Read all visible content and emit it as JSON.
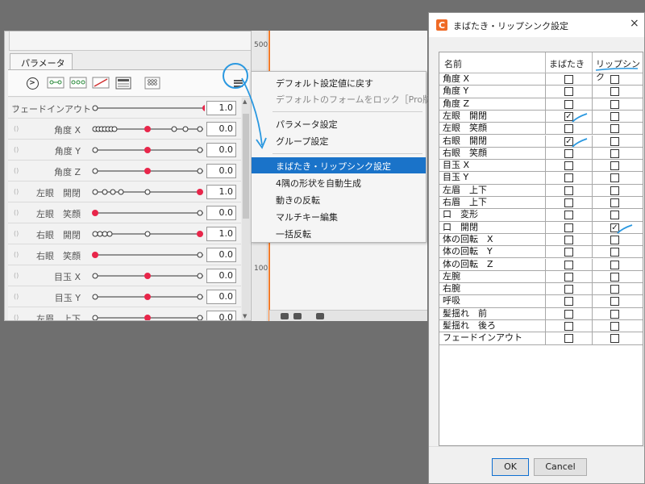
{
  "param_panel": {
    "tab_label": "パラメータ",
    "rows": [
      {
        "name": "フェードインアウト",
        "value": "1.0"
      },
      {
        "name": "角度 X",
        "value": "0.0"
      },
      {
        "name": "角度 Y",
        "value": "0.0"
      },
      {
        "name": "角度 Z",
        "value": "0.0"
      },
      {
        "name": "左眼　開閉",
        "value": "1.0"
      },
      {
        "name": "左眼　笑顔",
        "value": "0.0"
      },
      {
        "name": "右眼　開閉",
        "value": "1.0"
      },
      {
        "name": "右眼　笑顔",
        "value": "0.0"
      },
      {
        "name": "目玉 X",
        "value": "0.0"
      },
      {
        "name": "目玉 Y",
        "value": "0.0"
      },
      {
        "name": "左眉　上下",
        "value": "0.0"
      }
    ]
  },
  "canvas": {
    "ruler_labels": [
      "500",
      "100"
    ]
  },
  "context_menu": {
    "items": [
      {
        "label": "デフォルト設定値に戻す",
        "state": "normal"
      },
      {
        "label": "デフォルトのフォームをロック［Pro版］",
        "state": "disabled"
      },
      {
        "label": "パラメータ設定",
        "state": "normal"
      },
      {
        "label": "グループ設定",
        "state": "normal"
      },
      {
        "label": "まばたき・リップシンク設定",
        "state": "selected"
      },
      {
        "label": "4隅の形状を自動生成",
        "state": "normal"
      },
      {
        "label": "動きの反転",
        "state": "normal"
      },
      {
        "label": "マルチキー編集",
        "state": "normal"
      },
      {
        "label": "一括反転",
        "state": "normal"
      }
    ]
  },
  "dialog": {
    "title": "まばたき・リップシンク設定",
    "close_glyph": "×",
    "headers": {
      "name": "名前",
      "blink": "まばたき",
      "lipsync": "リップシンク"
    },
    "rows": [
      {
        "name": "角度 X",
        "blink": false,
        "lipsync": false
      },
      {
        "name": "角度 Y",
        "blink": false,
        "lipsync": false
      },
      {
        "name": "角度 Z",
        "blink": false,
        "lipsync": false
      },
      {
        "name": "左眼　開閉",
        "blink": true,
        "lipsync": false
      },
      {
        "name": "左眼　笑顔",
        "blink": false,
        "lipsync": false
      },
      {
        "name": "右眼　開閉",
        "blink": true,
        "lipsync": false
      },
      {
        "name": "右眼　笑顔",
        "blink": false,
        "lipsync": false
      },
      {
        "name": "目玉 X",
        "blink": false,
        "lipsync": false
      },
      {
        "name": "目玉 Y",
        "blink": false,
        "lipsync": false
      },
      {
        "name": "左眉　上下",
        "blink": false,
        "lipsync": false
      },
      {
        "name": "右眉　上下",
        "blink": false,
        "lipsync": false
      },
      {
        "name": "口　変形",
        "blink": false,
        "lipsync": false
      },
      {
        "name": "口　開閉",
        "blink": false,
        "lipsync": true
      },
      {
        "name": "体の回転　X",
        "blink": false,
        "lipsync": false
      },
      {
        "name": "体の回転　Y",
        "blink": false,
        "lipsync": false
      },
      {
        "name": "体の回転　Z",
        "blink": false,
        "lipsync": false
      },
      {
        "name": "左腕",
        "blink": false,
        "lipsync": false
      },
      {
        "name": "右腕",
        "blink": false,
        "lipsync": false
      },
      {
        "name": "呼吸",
        "blink": false,
        "lipsync": false
      },
      {
        "name": "髪揺れ　前",
        "blink": false,
        "lipsync": false
      },
      {
        "name": "髪揺れ　後ろ",
        "blink": false,
        "lipsync": false
      },
      {
        "name": "フェードインアウト",
        "blink": false,
        "lipsync": false
      }
    ],
    "ok_label": "OK",
    "cancel_label": "Cancel"
  },
  "colors": {
    "accent": "#1a73c9",
    "keyframe_red": "#e8264a",
    "annotation_blue": "#2a98e0",
    "timeline_orange": "#f07a2a"
  },
  "icons": [
    "play-circle-icon",
    "add-keyform-icon",
    "add-keyform-3-icon",
    "delete-keyform-icon",
    "monitor-icon",
    "grid-icon",
    "hamburger-menu-icon",
    "lock-icon",
    "close-icon",
    "app-logo-icon"
  ]
}
